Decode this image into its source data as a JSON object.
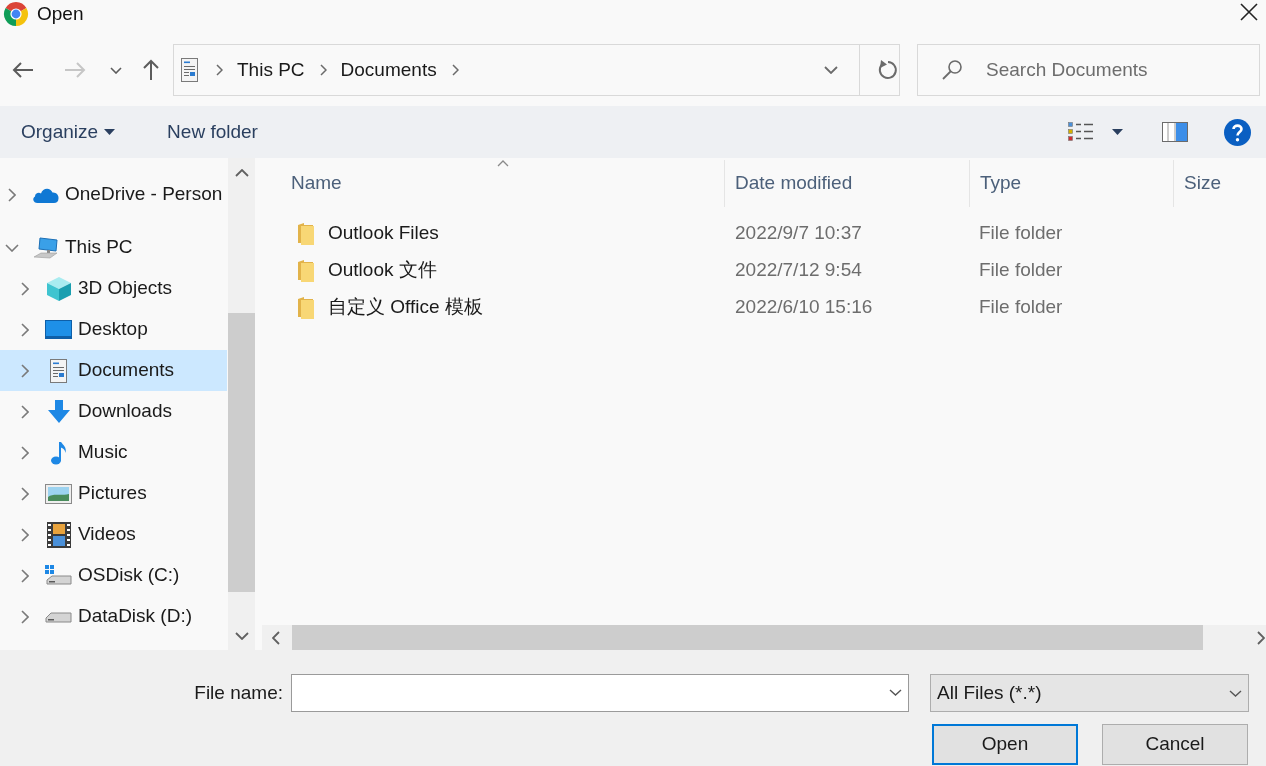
{
  "window": {
    "title": "Open"
  },
  "navigation": {
    "buttons": [
      {
        "kind": "back",
        "disabled": false
      },
      {
        "kind": "forward",
        "disabled": true
      },
      {
        "kind": "recent",
        "disabled": false
      },
      {
        "kind": "up",
        "disabled": false
      }
    ],
    "breadcrumb": [
      "This PC",
      "Documents"
    ],
    "search": {
      "placeholder": "Search Documents"
    }
  },
  "toolbar": {
    "items": [
      {
        "label": "Organize",
        "kind": "menu"
      },
      {
        "label": "New folder",
        "kind": "button"
      }
    ]
  },
  "sidebar": {
    "items": [
      {
        "label": "OneDrive - Person",
        "kind": "cloud",
        "expanded": false,
        "selected": false
      },
      {
        "label": "This PC",
        "kind": "computer",
        "expanded": true,
        "selected": false,
        "children": [
          {
            "label": "3D Objects",
            "kind": "cube",
            "expanded": false,
            "selected": false
          },
          {
            "label": "Desktop",
            "kind": "desktop",
            "expanded": false,
            "selected": false
          },
          {
            "label": "Documents",
            "kind": "document",
            "expanded": false,
            "selected": true
          },
          {
            "label": "Downloads",
            "kind": "download",
            "expanded": false,
            "selected": false
          },
          {
            "label": "Music",
            "kind": "music",
            "expanded": false,
            "selected": false
          },
          {
            "label": "Pictures",
            "kind": "picture",
            "expanded": false,
            "selected": false
          },
          {
            "label": "Videos",
            "kind": "video",
            "expanded": false,
            "selected": false
          },
          {
            "label": "OSDisk (C:)",
            "kind": "system-drive",
            "expanded": false,
            "selected": false
          },
          {
            "label": "DataDisk (D:)",
            "kind": "drive",
            "expanded": false,
            "selected": false
          }
        ]
      }
    ]
  },
  "file_list": {
    "columns": [
      {
        "label": "Name",
        "sorted": true
      },
      {
        "label": "Date modified",
        "sorted": false
      },
      {
        "label": "Type",
        "sorted": false
      },
      {
        "label": "Size",
        "sorted": false
      }
    ],
    "rows": [
      {
        "name": "Outlook Files",
        "date_modified": "2022/9/7 10:37",
        "type": "File folder"
      },
      {
        "name": "Outlook 文件",
        "date_modified": "2022/7/12 9:54",
        "type": "File folder"
      },
      {
        "name": "自定义 Office 模板",
        "date_modified": "2022/6/10 15:16",
        "type": "File folder"
      }
    ]
  },
  "footer": {
    "file_name": {
      "label": "File name:"
    },
    "file_type": {
      "value": "All Files (*.*)"
    },
    "buttons": [
      {
        "label": "Open",
        "default": true
      },
      {
        "label": "Cancel",
        "default": false
      }
    ]
  }
}
